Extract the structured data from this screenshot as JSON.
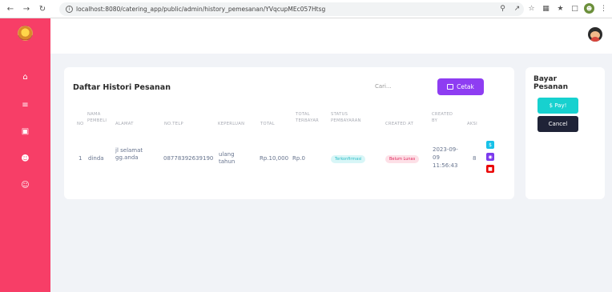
{
  "browser": {
    "url": "localhost:8080/catering_app/public/admin/history_pemesanan/YVqcupMEc057Htsg"
  },
  "page": {
    "title": "Daftar Histori Pesanan",
    "search_placeholder": "Cari...",
    "print_label": "Cetak"
  },
  "table": {
    "headers": {
      "no": "NO",
      "nama": "NAMA PEMBELI",
      "alamat": "ALAMAT",
      "telp": "NO.TELP",
      "keperluan": "KEPERLUAN",
      "total": "TOTAL",
      "total_terbayar": "TOTAL TERBAYAR",
      "status": "STATUS PEMBAYARAN",
      "created_at": "CREATED AT",
      "created_by": "CREATED BY",
      "aksi": "AKSI"
    },
    "rows": [
      {
        "no": "1",
        "nama": "dinda",
        "alamat": "jl selamat gg.anda",
        "telp": "08778392639190",
        "keperluan": "ulang tahun",
        "total": "Rp.10,000",
        "total_terbayar": "Rp.0",
        "status": "Terkonfirmasi",
        "created_at": "Belum Lunas",
        "created_by": "2023-09-09 11:56:43",
        "extra": "8"
      }
    ]
  },
  "payment": {
    "title": "Bayar Pesanan",
    "pay_label": "$ Pay!",
    "cancel_label": "Cancel"
  },
  "colors": {
    "sidebar": "#f73e67",
    "primary": "#8e3df2",
    "teal": "#17d1cf",
    "dark": "#1f2337"
  }
}
